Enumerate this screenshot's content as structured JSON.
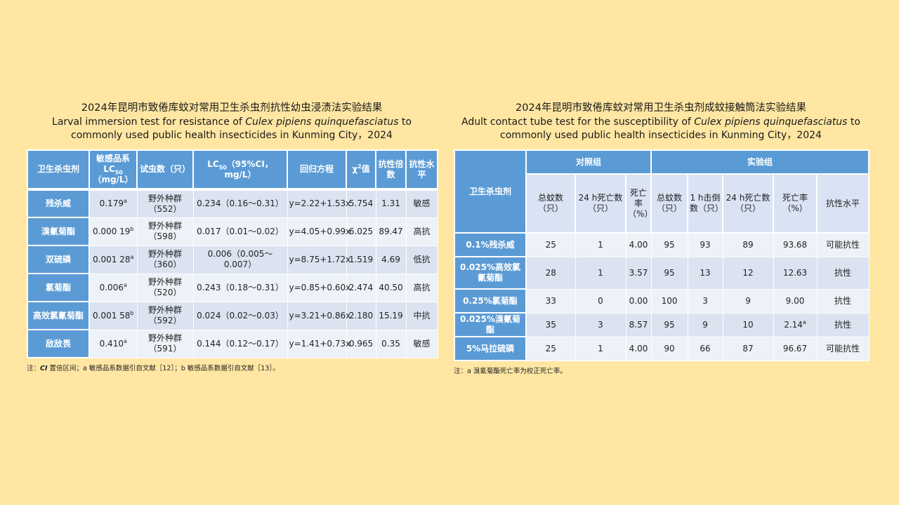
{
  "left": {
    "title_cn": "2024年昆明市致倦库蚊对常用卫生杀虫剂抗性幼虫浸渍法实验结果",
    "title_en_pre": "Larval immersion test for resistance of ",
    "title_en_species": "Culex pipiens quinquefasciatus",
    "title_en_post": " to commonly used public health insecticides in Kunming City，2024",
    "headers": {
      "insecticide": "卫生杀虫剂",
      "lc50_a": "敏感品系",
      "lc50_b": "LC",
      "lc50_sub": "50",
      "lc50_c": "（mg/L）",
      "count": "试虫数（只）",
      "ci_a": "LC",
      "ci_sub": "50",
      "ci_b": "（95%CI，mg/L）",
      "regression": "回归方程",
      "chi_a": "χ",
      "chi_sup": "2",
      "chi_b": "值",
      "ratio": "抗性倍数",
      "level": "抗性水平"
    },
    "rows": [
      {
        "name": "残杀威",
        "lc50": "0.179",
        "mark": "a",
        "pop": "野外种群",
        "n": "（552）",
        "ci": "0.234（0.16～0.31）",
        "eq": "y=2.22+1.53x",
        "chi": "5.754",
        "ratio": "1.31",
        "level": "敏感"
      },
      {
        "name": "溴氰菊酯",
        "lc50": "0.000 19",
        "mark": "b",
        "pop": "野外种群",
        "n": "（598）",
        "ci": "0.017（0.01～0.02）",
        "eq": "y=4.05+0.99x",
        "chi": "6.025",
        "ratio": "89.47",
        "level": "高抗"
      },
      {
        "name": "双硫磷",
        "lc50": "0.001 28",
        "mark": "a",
        "pop": "野外种群",
        "n": "（360）",
        "ci": "0.006（0.005～0.007）",
        "eq": "y=8.75+1.72x",
        "chi": "1.519",
        "ratio": "4.69",
        "level": "低抗"
      },
      {
        "name": "氯菊酯",
        "lc50": "0.006",
        "mark": "a",
        "pop": "野外种群",
        "n": "（520）",
        "ci": "0.243（0.18～0.31）",
        "eq": "y=0.85+0.60x",
        "chi": "2.474",
        "ratio": "40.50",
        "level": "高抗"
      },
      {
        "name": "高效氯氰菊酯",
        "lc50": "0.001 58",
        "mark": "b",
        "pop": "野外种群",
        "n": "（592）",
        "ci": "0.024（0.02～0.03）",
        "eq": "y=3.21+0.86x",
        "chi": "2.180",
        "ratio": "15.19",
        "level": "中抗"
      },
      {
        "name": "敌敌畏",
        "lc50": "0.410",
        "mark": "a",
        "pop": "野外种群",
        "n": "（591）",
        "ci": "0.144（0.12～0.17）",
        "eq": "y=1.41+0.73x",
        "chi": "0.965",
        "ratio": "0.35",
        "level": "敏感"
      }
    ],
    "note_pre": "注：",
    "note_ci": "CI",
    "note_post": " 置信区间；a 敏感品系数据引自文献［12］；b 敏感品系数据引自文献［13］。"
  },
  "right": {
    "title_cn": "2024年昆明市致倦库蚊对常用卫生杀虫剂成蚊接触筒法实验结果",
    "title_en_pre": "Adult contact tube test for the susceptibility of ",
    "title_en_species": "Culex pipiens quinquefasciatus",
    "title_en_post": " to commonly used public health insecticides in Kunming City，2024",
    "headers": {
      "insecticide": "卫生杀虫剂",
      "control": "对照组",
      "experiment": "实验组",
      "c_total": "总蚊数（只）",
      "c_dead24": "24 h死亡数（只）",
      "c_rate": "死亡率（%）",
      "e_total": "总蚊数（只）",
      "e_knock": "1 h击倒数（只）",
      "e_dead24": "24 h死亡数（只）",
      "e_rate": "死亡率（%）",
      "e_level": "抗性水平"
    },
    "rows": [
      {
        "name": "0.1%残杀威",
        "c_total": "25",
        "c_dead": "1",
        "c_rate": "4.00",
        "e_total": "95",
        "e_knock": "93",
        "e_dead": "89",
        "e_rate": "93.68",
        "mark": "",
        "level": "可能抗性"
      },
      {
        "name": "0.025%高效氯氰菊酯",
        "c_total": "28",
        "c_dead": "1",
        "c_rate": "3.57",
        "e_total": "95",
        "e_knock": "13",
        "e_dead": "12",
        "e_rate": "12.63",
        "mark": "",
        "level": "抗性"
      },
      {
        "name": "0.25%氯菊酯",
        "c_total": "33",
        "c_dead": "0",
        "c_rate": "0.00",
        "e_total": "100",
        "e_knock": "3",
        "e_dead": "9",
        "e_rate": "9.00",
        "mark": "",
        "level": "抗性"
      },
      {
        "name": "0.025%溴氰菊酯",
        "c_total": "35",
        "c_dead": "3",
        "c_rate": "8.57",
        "e_total": "95",
        "e_knock": "9",
        "e_dead": "10",
        "e_rate": "2.14",
        "mark": "a",
        "level": "抗性"
      },
      {
        "name": "5%马拉硫磷",
        "c_total": "25",
        "c_dead": "1",
        "c_rate": "4.00",
        "e_total": "90",
        "e_knock": "66",
        "e_dead": "87",
        "e_rate": "96.67",
        "mark": "",
        "level": "可能抗性"
      }
    ],
    "note": "注：a 溴氰菊酯死亡率为校正死亡率。"
  }
}
